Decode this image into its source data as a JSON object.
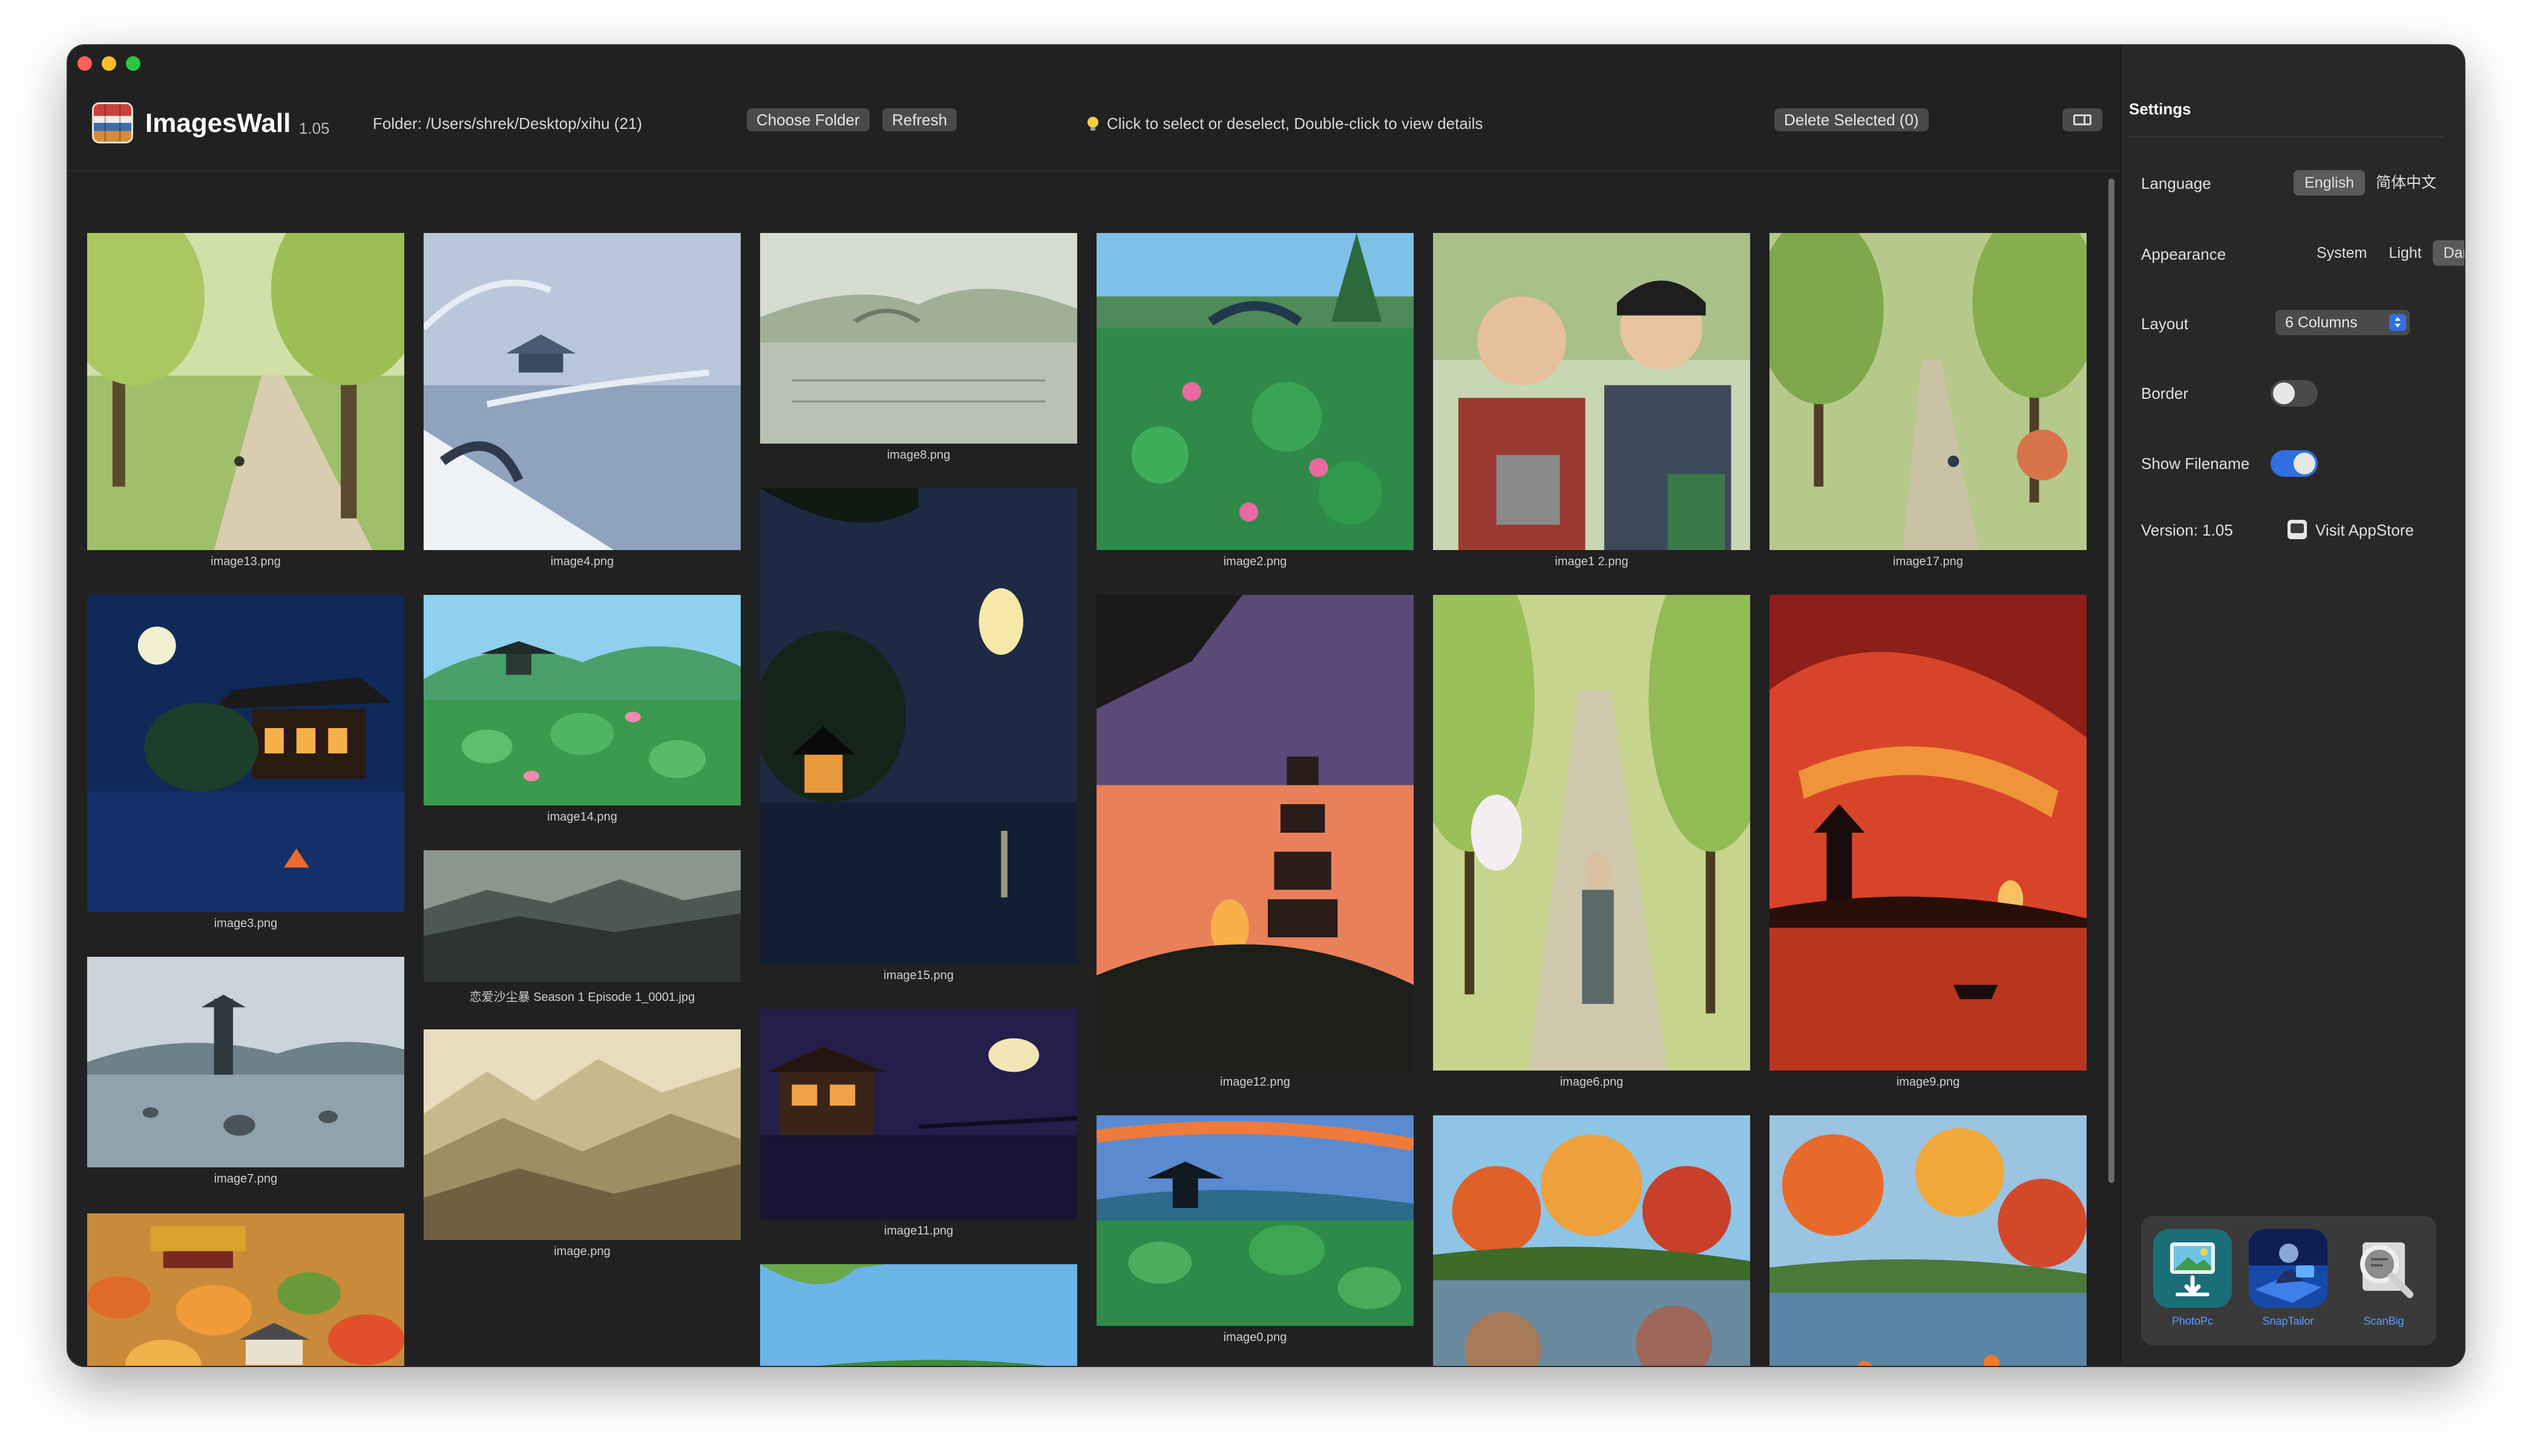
{
  "app": {
    "name": "ImagesWall",
    "version": "1.05",
    "folder_label": "Folder: /Users/shrek/Desktop/xihu  (21)",
    "choose_folder": "Choose Folder",
    "refresh": "Refresh",
    "hint": "Click to select or deselect, Double-click to view details",
    "delete_selected": "Delete Selected (0)"
  },
  "gallery": {
    "images": [
      {
        "filename": "image13.png",
        "scene": "willow-path"
      },
      {
        "filename": "image4.png",
        "scene": "snow-lake"
      },
      {
        "filename": "image8.png",
        "scene": "misty-lake"
      },
      {
        "filename": "image2.png",
        "scene": "lotus-bridge"
      },
      {
        "filename": "image1 2.png",
        "scene": "two-men"
      },
      {
        "filename": "image17.png",
        "scene": "tree-avenue"
      },
      {
        "filename": "image3.png",
        "scene": "night-pavilion"
      },
      {
        "filename": "image14.png",
        "scene": "lotus-pavilion"
      },
      {
        "filename": "image15.png",
        "scene": "moon-lake"
      },
      {
        "filename": "image12.png",
        "scene": "sunset-pagoda"
      },
      {
        "filename": "image6.png",
        "scene": "monk-path"
      },
      {
        "filename": "image9.png",
        "scene": "red-sky-pagoda"
      },
      {
        "filename": "恋爱沙尘暴 Season 1 Episode 1_0001.jpg",
        "scene": "mountain-haze"
      },
      {
        "filename": "image7.png",
        "scene": "lake-pagoda"
      },
      {
        "filename": "image.png",
        "scene": "sketch-mountains"
      },
      {
        "filename": "image11.png",
        "scene": "night-cabin"
      },
      {
        "filename": "image0.png",
        "scene": "lotus-pagoda"
      },
      {
        "filename": "",
        "scene": "autumn-village"
      },
      {
        "filename": "",
        "scene": "willow-lake"
      },
      {
        "filename": "",
        "scene": "autumn-reflection"
      },
      {
        "filename": "",
        "scene": "autumn-koi"
      }
    ]
  },
  "settings": {
    "title": "Settings",
    "language": {
      "label": "Language",
      "options": [
        "English",
        "简体中文"
      ],
      "selected": "English"
    },
    "appearance": {
      "label": "Appearance",
      "options": [
        "System",
        "Light",
        "Dark"
      ],
      "selected": "Dark"
    },
    "layout": {
      "label": "Layout",
      "value": "6 Columns"
    },
    "border": {
      "label": "Border",
      "on": false
    },
    "show_filename": {
      "label": "Show Filename",
      "on": true
    },
    "version_label": "Version: 1.05",
    "visit_appstore": "Visit AppStore"
  },
  "promo_apps": [
    {
      "name": "PhotoPc",
      "icon": "photo-download-icon"
    },
    {
      "name": "SnapTailor",
      "icon": "snaptailor-icon"
    },
    {
      "name": "ScanBig",
      "icon": "magnifier-icon"
    }
  ],
  "colors": {
    "window_bg": "#212121",
    "sidebar_bg": "#282828",
    "accent": "#2f6fe0",
    "promo_text": "#5b9bff"
  }
}
